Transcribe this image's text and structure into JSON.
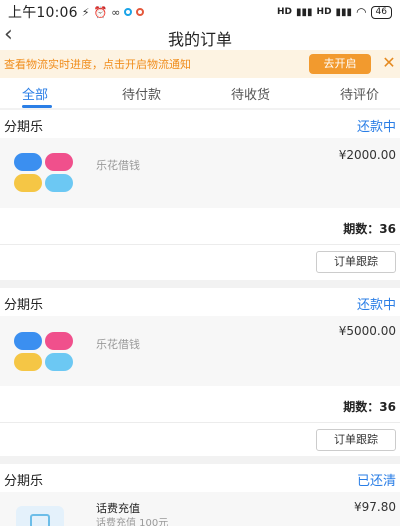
{
  "status_bar": {
    "time": "上午10:06",
    "battery": "46",
    "signal_1": "HD",
    "signal_2": "HD"
  },
  "nav": {
    "title": "我的订单"
  },
  "notice": {
    "text": "查看物流实时进度，点击开启物流通知",
    "button": "去开启"
  },
  "tabs": [
    "全部",
    "待付款",
    "待收货",
    "待评价"
  ],
  "orders": [
    {
      "category": "分期乐",
      "status": "还款中",
      "product": "乐花借钱",
      "price": "¥2000.00",
      "periods": "期数：36",
      "action": "订单跟踪"
    },
    {
      "category": "分期乐",
      "status": "还款中",
      "product": "乐花借钱",
      "price": "¥5000.00",
      "periods": "期数：36",
      "action": "订单跟踪"
    },
    {
      "category": "分期乐",
      "status": "已还清",
      "product": "话费充值",
      "subtitle": "话费充值 100元",
      "price": "¥97.80"
    }
  ],
  "colors": {
    "accent": "#2a7ee6",
    "notice_bg": "#fdf3e2",
    "notice_text": "#f08c1a"
  }
}
